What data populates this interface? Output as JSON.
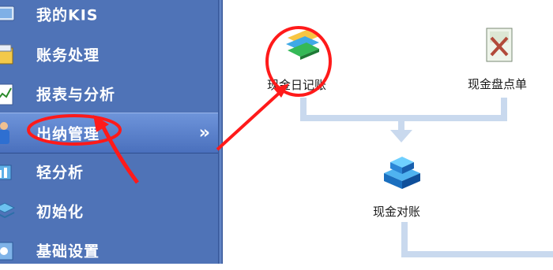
{
  "sidebar": {
    "items": [
      {
        "label": "我的KIS",
        "icon": "monitor-icon"
      },
      {
        "label": "账务处理",
        "icon": "ledger-icon"
      },
      {
        "label": "报表与分析",
        "icon": "report-chart-icon"
      },
      {
        "label": "出纳管理",
        "icon": "cashier-person-icon",
        "chevron": "»"
      },
      {
        "label": "轻分析",
        "icon": "analysis-icon"
      },
      {
        "label": "初始化",
        "icon": "layers-icon"
      },
      {
        "label": "基础设置",
        "icon": "settings-box-icon"
      }
    ]
  },
  "flow": {
    "cash_journal": {
      "label": "现金日记账",
      "icon": "books-icon"
    },
    "cash_count": {
      "label": "现金盘点单",
      "icon": "count-sheet-icon"
    },
    "cash_reconcile": {
      "label": "现金对账",
      "icon": "reconcile-stack-icon"
    }
  },
  "colors": {
    "sidebar_bg": "#4f73b7",
    "annotation_red": "#ff1a1a",
    "flow_line": "#c9d9ee"
  }
}
